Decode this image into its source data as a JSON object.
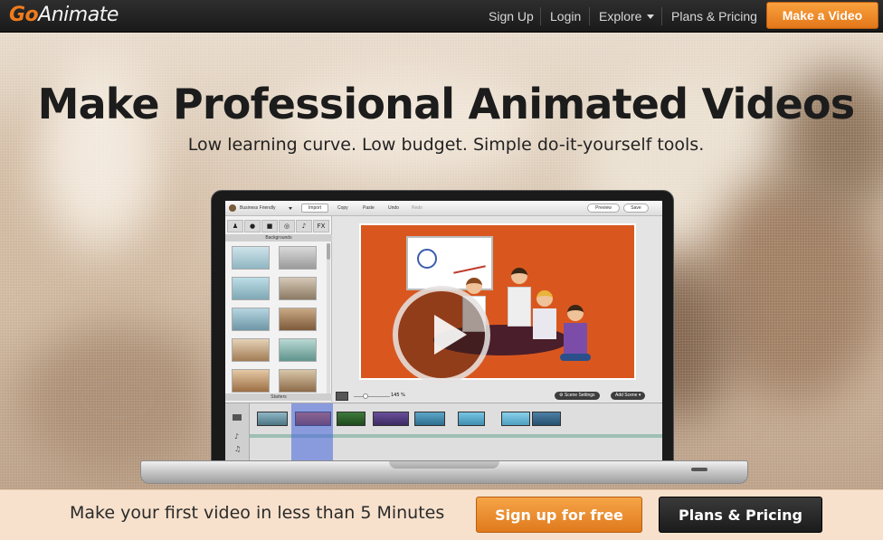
{
  "brand": {
    "go": "Go",
    "animate": "Animate",
    "accent": "#ee7b1d"
  },
  "nav": {
    "sign_up": "Sign Up",
    "login": "Login",
    "explore": "Explore",
    "plans_pricing": "Plans & Pricing",
    "make_video": "Make a Video"
  },
  "hero": {
    "title": "Make Professional Animated Videos",
    "subtitle": "Low learning curve. Low budget. Simple do-it-yourself tools."
  },
  "app": {
    "theme_select": "Business Friendly",
    "import_label": "Import",
    "copy": "Copy",
    "paste": "Paste",
    "undo": "Undo",
    "redo": "Redo",
    "preview": "Preview",
    "save": "Save",
    "tabs": [
      "♟",
      "●",
      "■",
      "◎",
      "♪",
      "FX"
    ],
    "backgrounds_label": "Backgrounds",
    "starters_label": "Starters",
    "zoom": "145 %",
    "scene_settings": "Scene Settings",
    "add_scene": "Add Scene"
  },
  "cta": {
    "text": "Make your first video in less than 5 Minutes",
    "signup": "Sign up for free",
    "plans": "Plans & Pricing"
  },
  "colors": {
    "orange_button": "#e9841f",
    "dark_button": "#222222",
    "bottom_bar": "#f7e1cc",
    "stage": "#d9571f"
  }
}
